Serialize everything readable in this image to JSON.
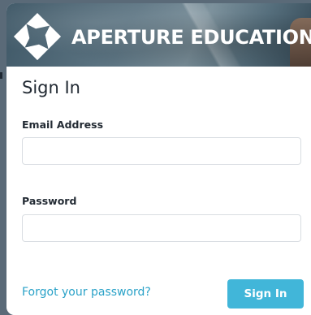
{
  "header": {
    "brand_name": "APERTURE EDUCATION",
    "logo_icon": "aperture-diamond-logo-icon"
  },
  "signin": {
    "title": "Sign In",
    "email_label": "Email Address",
    "email_value": "",
    "email_placeholder": "",
    "password_label": "Password",
    "password_value": "",
    "password_placeholder": "",
    "forgot_link": "Forgot your password?",
    "submit_label": "Sign In"
  },
  "colors": {
    "accent": "#41b6d9",
    "link": "#2aa2c8",
    "text": "#222a33"
  }
}
